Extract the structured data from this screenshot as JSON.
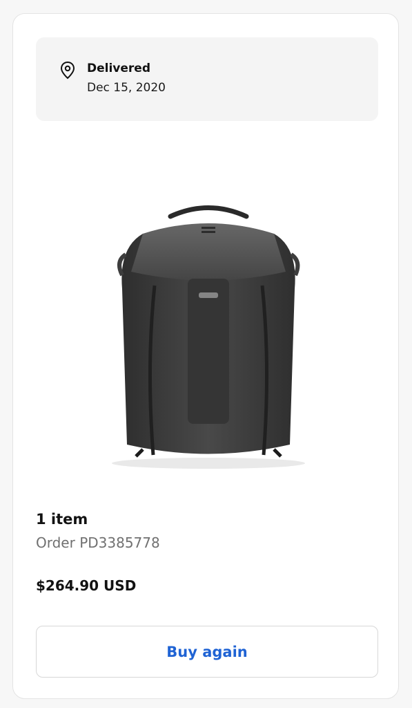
{
  "delivery": {
    "status": "Delivered",
    "date": "Dec 15, 2020"
  },
  "product": {
    "icon": "backpack-image"
  },
  "order": {
    "item_count": "1 item",
    "order_number": "Order PD3385778",
    "total": "$264.90 USD"
  },
  "actions": {
    "buy_again_label": "Buy again"
  },
  "colors": {
    "accent": "#1f63d4",
    "muted_text": "#707070",
    "status_bg": "#f4f4f4"
  }
}
